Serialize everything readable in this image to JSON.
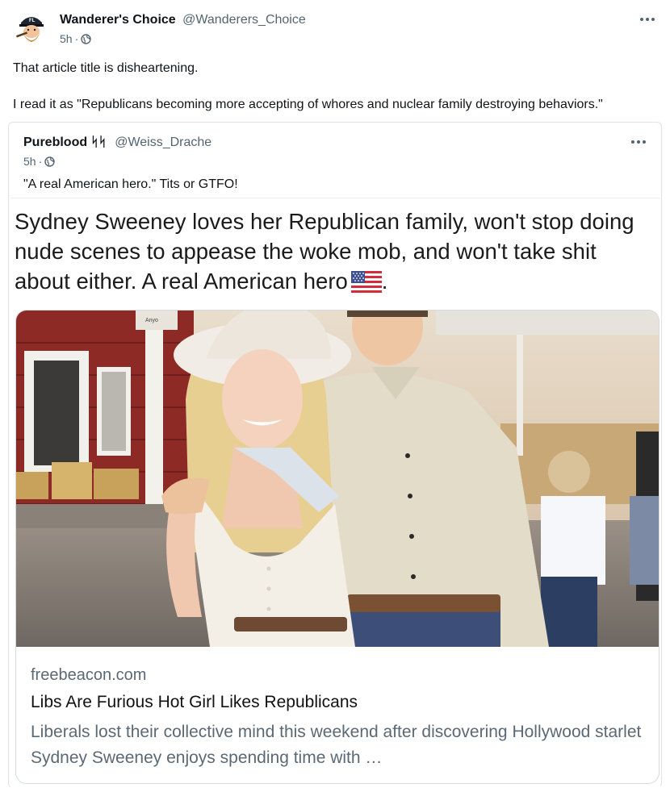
{
  "post": {
    "author_name": "Wanderer's Choice",
    "author_handle": "@Wanderers_Choice",
    "time": "5h",
    "separator": "·",
    "text_line1": "That article title is disheartening.",
    "text_line2": "I read it as \"Republicans becoming more accepting of whores and nuclear family destroying behaviors.\"",
    "avatar_cap_text": "FL"
  },
  "quoted": {
    "author_name": "Pureblood ᛋᛋ",
    "author_handle": "@Weiss_Drache",
    "time": "5h",
    "separator": "·",
    "text": "\"A real American hero.\" Tits or GTFO!"
  },
  "embed": {
    "headline": "Sydney Sweeney loves her Republican family, won't stop doing nude scenes to appease the woke mob, and won't take shit about either. A real American hero",
    "headline_end": ".",
    "photo_sign_text": "Anyo",
    "card": {
      "domain": "freebeacon.com",
      "title": "Libs Are Furious Hot Girl Likes Republicans",
      "description": "Liberals lost their collective mind this weekend after discovering Hollywood starlet Sydney Sweeney enjoys spending time with …"
    }
  },
  "icons": {
    "more": "more-options-icon",
    "globe": "globe-icon",
    "flag": "us-flag-emoji"
  },
  "colors": {
    "text_primary": "#0f1419",
    "text_secondary": "#536471",
    "border": "#dfe3e8"
  }
}
